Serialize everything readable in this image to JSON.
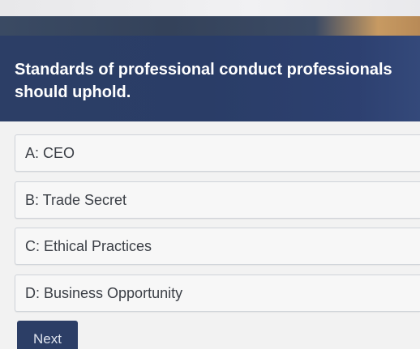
{
  "question": {
    "text": "Standards of professional conduct professionals should uphold."
  },
  "options": [
    {
      "label": "A: CEO"
    },
    {
      "label": "B: Trade Secret"
    },
    {
      "label": "C: Ethical Practices"
    },
    {
      "label": "D: Business Opportunity"
    }
  ],
  "navigation": {
    "next_label": "Next"
  },
  "colors": {
    "panel": "#2c3e66",
    "option_background": "#f7f7f7",
    "option_border": "#cfd3d9"
  }
}
